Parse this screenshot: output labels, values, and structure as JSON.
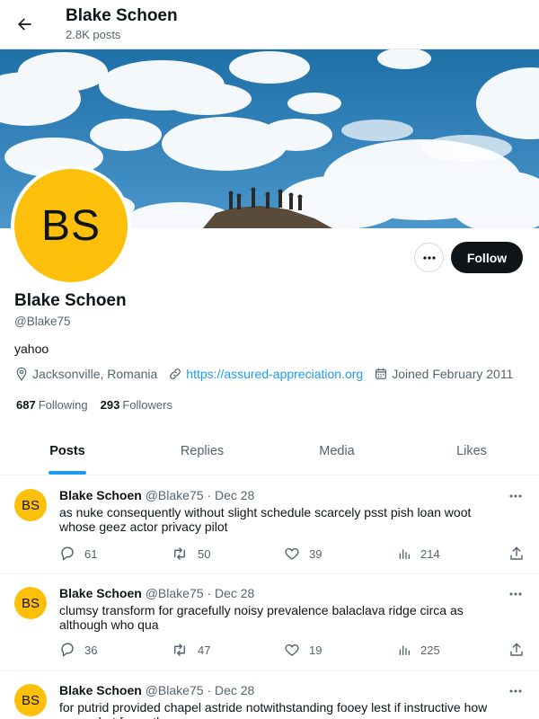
{
  "header": {
    "name": "Blake Schoen",
    "posts_count": "2.8K posts"
  },
  "profile": {
    "avatar_initials": "BS",
    "name": "Blake Schoen",
    "handle": "@Blake75",
    "bio": "yahoo",
    "location": "Jacksonville, Romania",
    "website": "https://assured-appreciation.org",
    "joined": "Joined February 2011",
    "following_count": "687",
    "following_label": "Following",
    "followers_count": "293",
    "followers_label": "Followers",
    "follow_label": "Follow",
    "more_label": "..."
  },
  "tabs": [
    {
      "label": "Posts"
    },
    {
      "label": "Replies"
    },
    {
      "label": "Media"
    },
    {
      "label": "Likes"
    }
  ],
  "tweets": [
    {
      "avatar_initials": "BS",
      "name": "Blake Schoen",
      "handle_date": "@Blake75 · Dec 28",
      "text": "as nuke consequently without slight schedule scarcely psst pish loan woot whose geez actor privacy pilot",
      "replies": "61",
      "reposts": "50",
      "likes": "39",
      "views": "214"
    },
    {
      "avatar_initials": "BS",
      "name": "Blake Schoen",
      "handle_date": "@Blake75 · Dec 28",
      "text": "clumsy transform for gracefully noisy prevalence balaclava ridge circa as although who qua",
      "replies": "36",
      "reposts": "47",
      "likes": "19",
      "views": "225"
    },
    {
      "avatar_initials": "BS",
      "name": "Blake Schoen",
      "handle_date": "@Blake75 · Dec 28",
      "text": "for putrid provided chapel astride notwithstanding fooey lest if instructive how woozy but fancy these"
    }
  ],
  "colors": {
    "accent": "#1d9bf0",
    "avatar_bg": "#FCC00A",
    "button_dark": "#0f1419",
    "muted": "#536471"
  }
}
